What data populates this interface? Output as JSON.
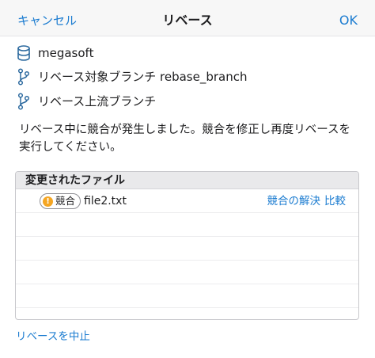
{
  "navbar": {
    "cancel_label": "キャンセル",
    "title": "リベース",
    "ok_label": "OK"
  },
  "repository": {
    "icon": "database-icon",
    "name": "megasoft"
  },
  "rebase_target": {
    "icon": "branch-icon",
    "text": "リベース対象ブランチ rebase_branch"
  },
  "upstream": {
    "icon": "branch-icon",
    "text": "リベース上流ブランチ"
  },
  "message": "リベース中に競合が発生しました。競合を修正し再度リベースを実行してください。",
  "files": {
    "header": "変更されたファイル",
    "rows": [
      {
        "badge_icon": "warning-icon",
        "badge_label": "競合",
        "file_name": "file2.txt",
        "resolve_label": "競合の解決",
        "compare_label": "比較"
      }
    ]
  },
  "abort_label": "リベースを中止",
  "colors": {
    "accent": "#1a7bd0",
    "icon": "#2d6a9f",
    "warning": "#f5a623"
  }
}
